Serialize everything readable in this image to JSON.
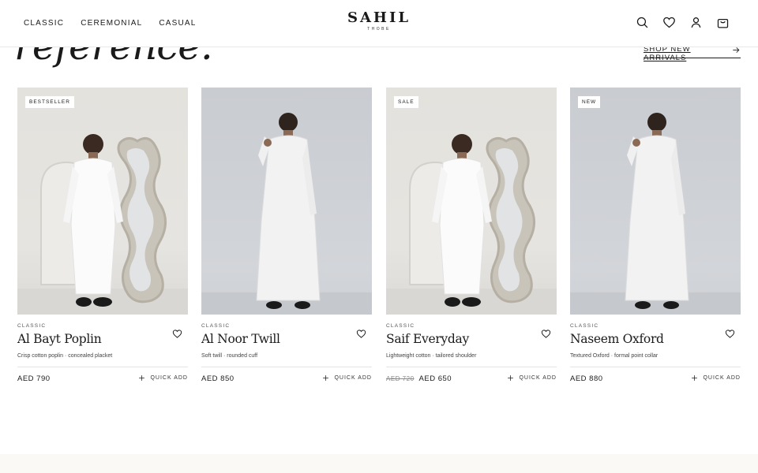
{
  "nav": {
    "items": [
      "CLASSIC",
      "CEREMONIAL",
      "CASUAL"
    ]
  },
  "brand": {
    "name": "SAHIL",
    "tagline": "THOBE"
  },
  "header_icons": [
    "search-icon",
    "heart-icon",
    "account-icon",
    "bag-icon"
  ],
  "hero": {
    "title_fragment": "reference.",
    "link_label": "SHOP NEW ARRIVALS"
  },
  "products": [
    {
      "badge": "BESTSELLER",
      "category": "CLASSIC",
      "name": "Al Bayt Poplin",
      "description": "Crisp cotton poplin · concealed placket",
      "price": "AED 790",
      "old_price": "",
      "quick_add": "QUICK ADD",
      "image": "mirror"
    },
    {
      "badge": "",
      "category": "CLASSIC",
      "name": "Al Noor Twill",
      "description": "Soft twill · rounded cuff",
      "price": "AED 850",
      "old_price": "",
      "quick_add": "QUICK ADD",
      "image": "grey"
    },
    {
      "badge": "SALE",
      "category": "CLASSIC",
      "name": "Saif Everyday",
      "description": "Lightweight cotton · tailored shoulder",
      "price": "AED 650",
      "old_price": "AED 720",
      "quick_add": "QUICK ADD",
      "image": "mirror"
    },
    {
      "badge": "NEW",
      "category": "CLASSIC",
      "name": "Naseem Oxford",
      "description": "Textured Oxford · formal point collar",
      "price": "AED 880",
      "old_price": "",
      "quick_add": "QUICK ADD",
      "image": "grey"
    }
  ],
  "colors": {
    "text": "#1a1a1a",
    "muted": "#888888",
    "image_bg_mirror": "#e4e2dd",
    "image_bg_grey": "#c9ccd1"
  }
}
